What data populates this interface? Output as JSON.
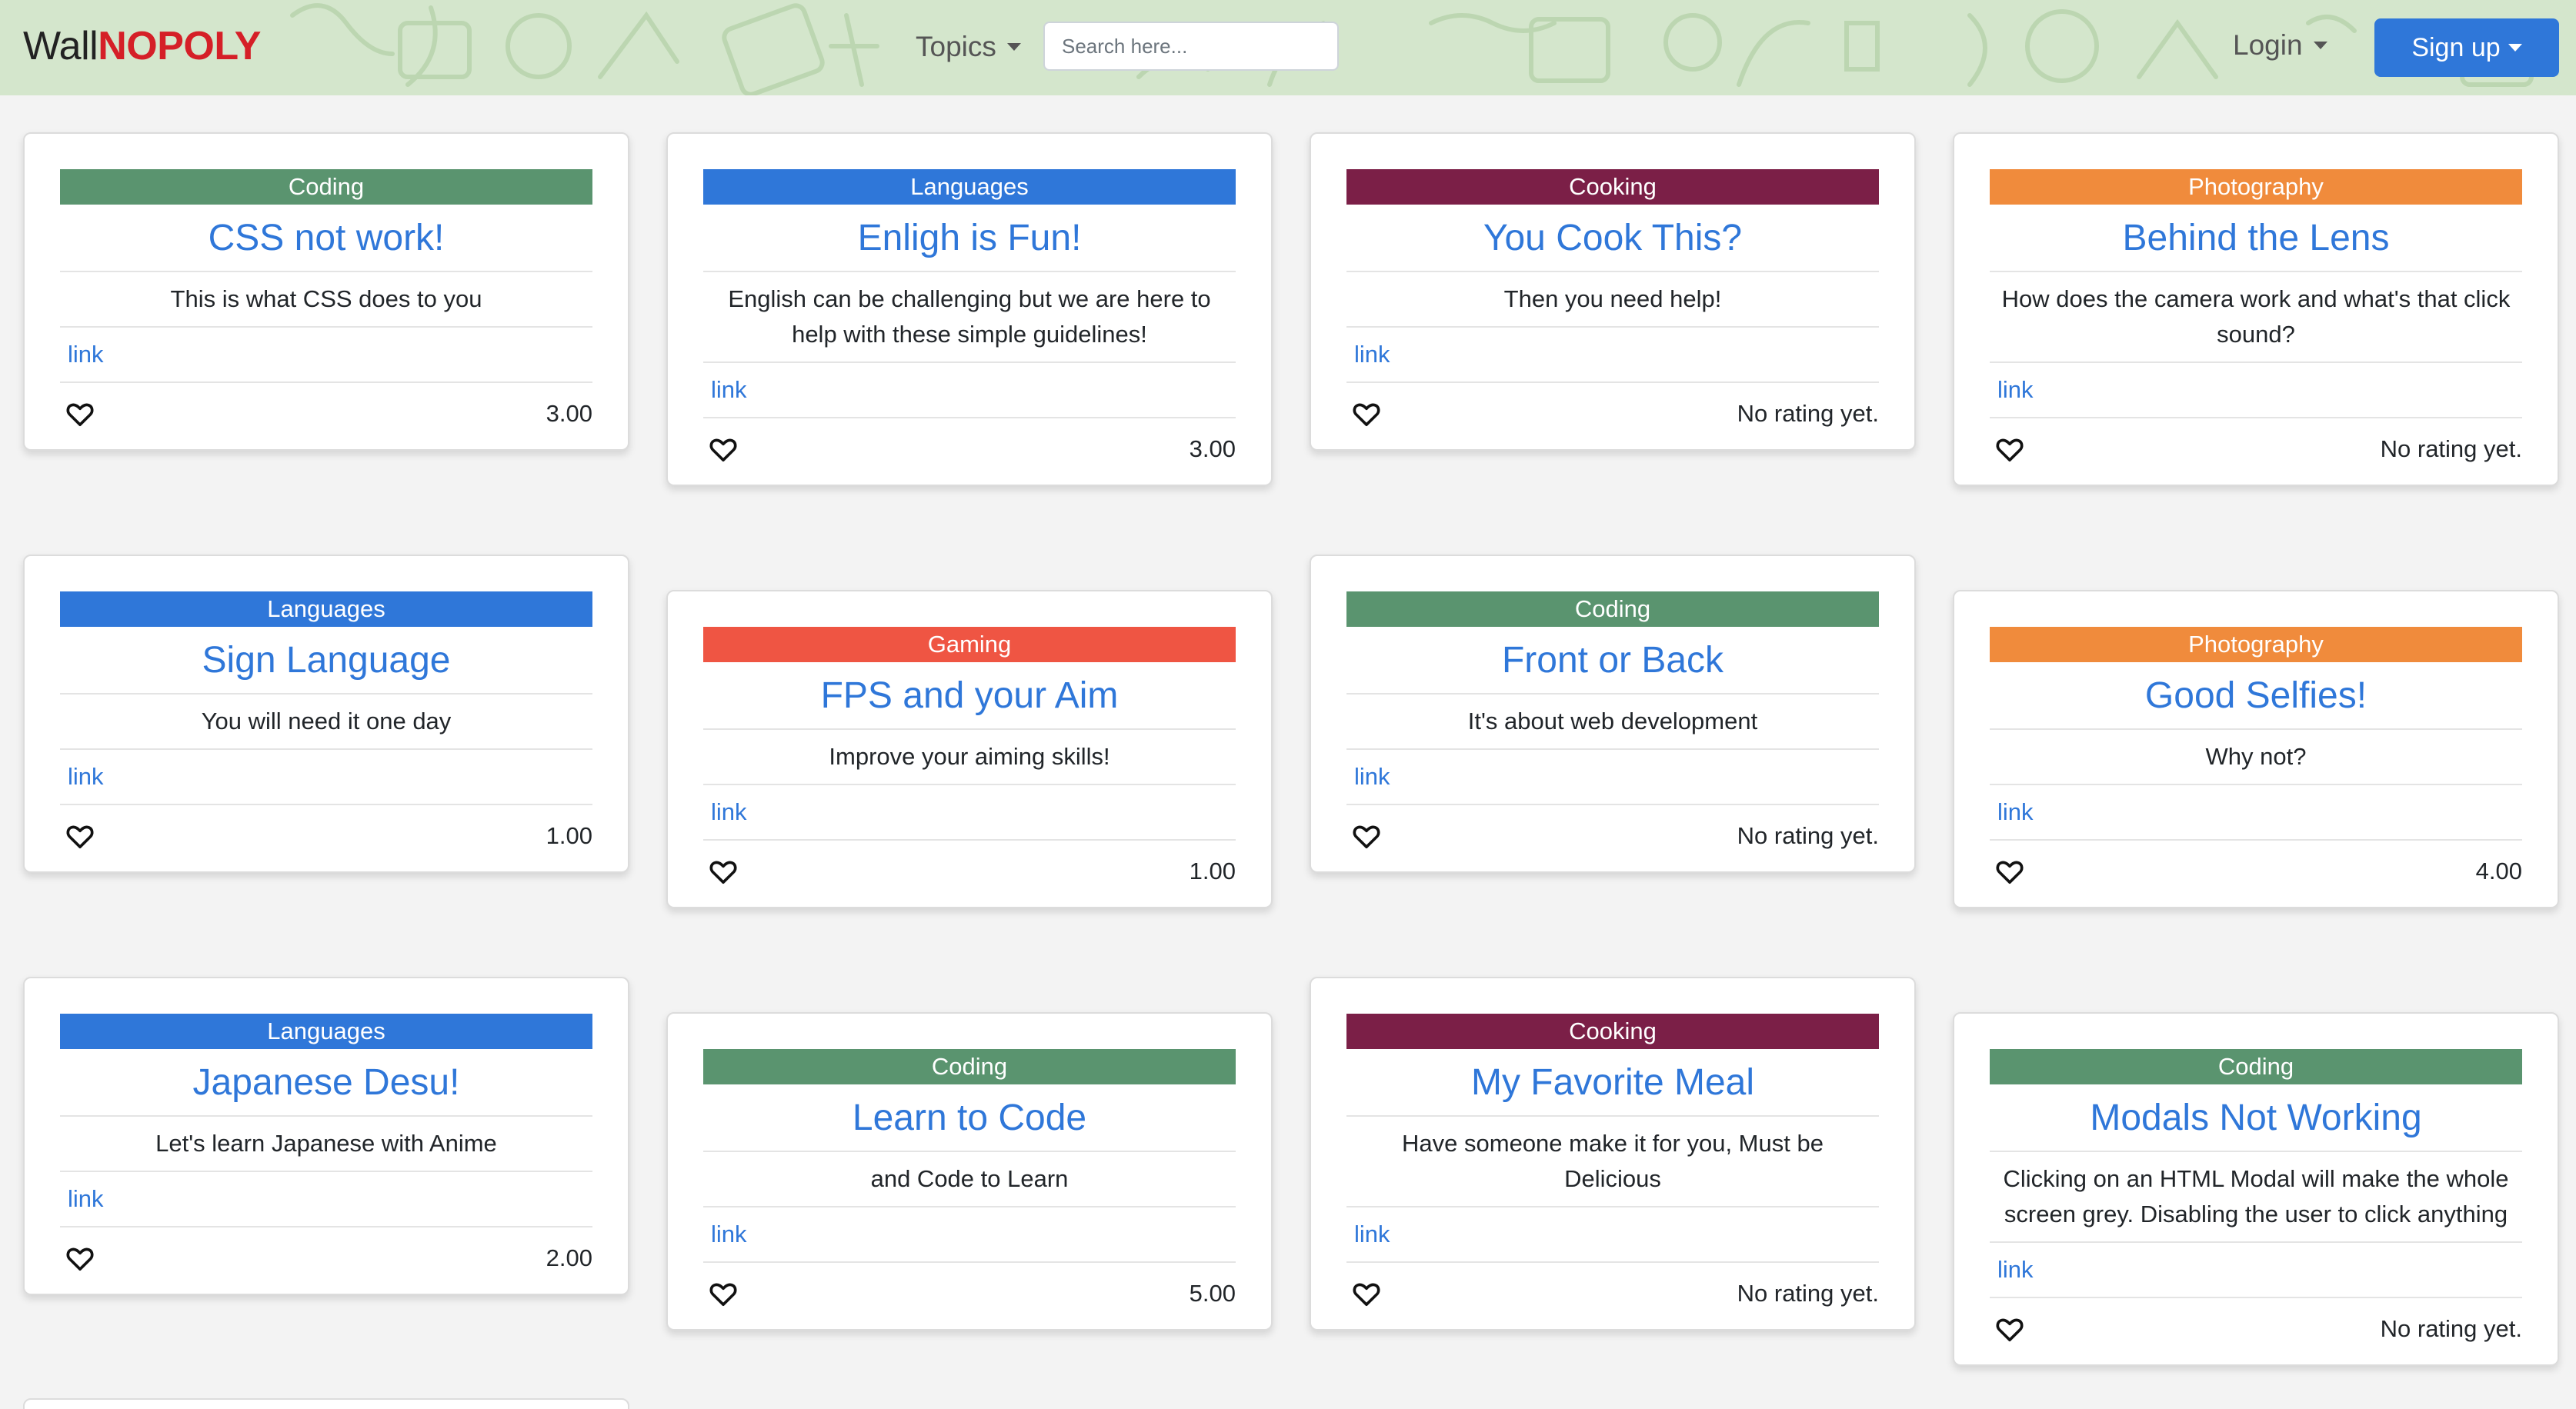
{
  "navbar": {
    "brand_part1": "Wall",
    "brand_part2": "NOPOLY",
    "topics_label": "Topics",
    "search_placeholder": "Search here...",
    "login_label": "Login",
    "signup_label": "Sign up"
  },
  "colors": {
    "Coding": "#5a946f",
    "Languages": "#2f77d9",
    "Cooking": "#7b1f47",
    "Photography": "#f08b3c",
    "Gaming": "#ef5543"
  },
  "cards": [
    {
      "category": "Coding",
      "title": "CSS not work!",
      "description": "This is what CSS does to you",
      "link": "link",
      "rating": "3.00"
    },
    {
      "category": "Languages",
      "title": "Enligh is Fun!",
      "description": "English can be challenging but we are here to help with these simple guidelines!",
      "link": "link",
      "rating": "3.00"
    },
    {
      "category": "Cooking",
      "title": "You Cook This?",
      "description": "Then you need help!",
      "link": "link",
      "rating": "No rating yet."
    },
    {
      "category": "Photography",
      "title": "Behind the Lens",
      "description": "How does the camera work and what's that click sound?",
      "link": "link",
      "rating": "No rating yet."
    },
    {
      "category": "Languages",
      "title": "Sign Language",
      "description": "You will need it one day",
      "link": "link",
      "rating": "1.00"
    },
    {
      "category": "Gaming",
      "title": "FPS and your Aim",
      "description": "Improve your aiming skills!",
      "link": "link",
      "rating": "1.00"
    },
    {
      "category": "Coding",
      "title": "Front or Back",
      "description": "It's about web development",
      "link": "link",
      "rating": "No rating yet."
    },
    {
      "category": "Photography",
      "title": "Good Selfies!",
      "description": "Why not?",
      "link": "link",
      "rating": "4.00"
    },
    {
      "category": "Languages",
      "title": "Japanese Desu!",
      "description": "Let's learn Japanese with Anime",
      "link": "link",
      "rating": "2.00"
    },
    {
      "category": "Coding",
      "title": "Learn to Code",
      "description": "and Code to Learn",
      "link": "link",
      "rating": "5.00"
    },
    {
      "category": "Cooking",
      "title": "My Favorite Meal",
      "description": "Have someone make it for you, Must be Delicious",
      "link": "link",
      "rating": "No rating yet."
    },
    {
      "category": "Coding",
      "title": "Modals Not Working",
      "description": "Clicking on an HTML Modal will make the whole screen grey. Disabling the user to click anything",
      "link": "link",
      "rating": "No rating yet."
    }
  ]
}
